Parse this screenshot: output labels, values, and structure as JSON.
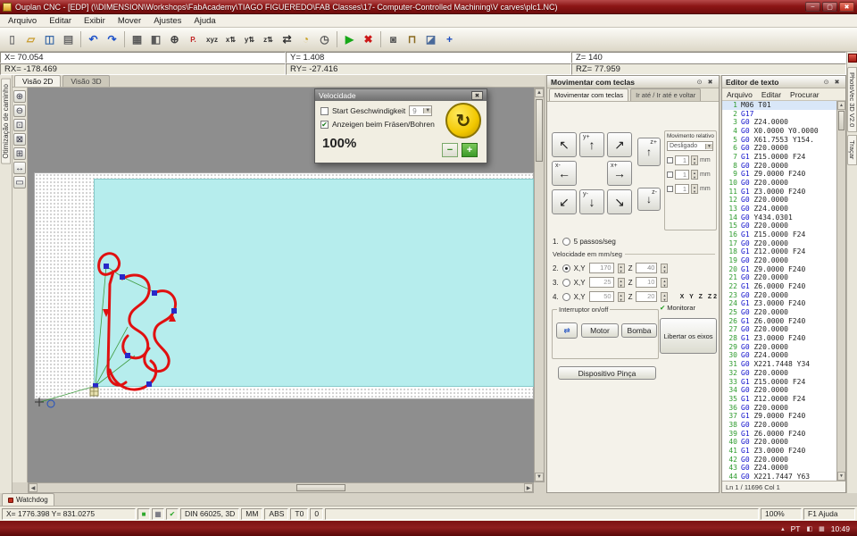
{
  "window": {
    "title": "Ouplan CNC - [EDP] (\\\\DIMENSION\\Workshops\\FabAcademy\\TIAGO FIGUEREDO\\FAB Classes\\17- Computer-Controlled Machining\\V carves\\plc1.NC)",
    "menus": [
      "Arquivo",
      "Editar",
      "Exibir",
      "Mover",
      "Ajustes",
      "Ajuda"
    ],
    "controls": {
      "min": "–",
      "max": "▢",
      "close": "✖"
    }
  },
  "toolbar": {
    "icons": [
      {
        "name": "new-file",
        "glyph": "▯",
        "color": "#7a7a7a"
      },
      {
        "name": "open-folder",
        "glyph": "▱",
        "color": "#c89a2a"
      },
      {
        "name": "save",
        "glyph": "◫",
        "color": "#3a6aa8"
      },
      {
        "name": "print",
        "glyph": "▤",
        "color": "#6a6a6a"
      },
      {
        "sep": true
      },
      {
        "name": "undo",
        "glyph": "↶",
        "color": "#1b50c8"
      },
      {
        "name": "redo",
        "glyph": "↷",
        "color": "#1b50c8"
      },
      {
        "sep": true
      },
      {
        "name": "grid-view",
        "glyph": "▦",
        "color": "#5a5a5a"
      },
      {
        "name": "layout",
        "glyph": "◧",
        "color": "#5a5a5a"
      },
      {
        "name": "zoom-tool",
        "glyph": "⊕",
        "color": "#444444"
      },
      {
        "name": "edit-p",
        "glyph": "P.",
        "color": "#c02020"
      },
      {
        "name": "axes-xyz",
        "glyph": "xyz",
        "color": "#333333"
      },
      {
        "name": "axis-x",
        "glyph": "x⇅",
        "color": "#333333"
      },
      {
        "name": "axis-y",
        "glyph": "y⇅",
        "color": "#333333"
      },
      {
        "name": "axis-z",
        "glyph": "z⇅",
        "color": "#333333"
      },
      {
        "name": "offsets",
        "glyph": "⇄",
        "color": "#333333"
      },
      {
        "name": "protractor",
        "glyph": "◔",
        "color": "#c8a020"
      },
      {
        "name": "timer",
        "glyph": "◷",
        "color": "#5a5a5a"
      },
      {
        "sep": true
      },
      {
        "name": "run",
        "glyph": "▶",
        "color": "#18a818"
      },
      {
        "name": "stop",
        "glyph": "✖",
        "color": "#cc1818"
      },
      {
        "sep": true
      },
      {
        "name": "snapshot",
        "glyph": "◙",
        "color": "#5a5a5a"
      },
      {
        "name": "scale",
        "glyph": "⊓",
        "color": "#8a6a20"
      },
      {
        "name": "report",
        "glyph": "◪",
        "color": "#4a6a9a"
      },
      {
        "name": "move-cross",
        "glyph": "+",
        "color": "#2050c0"
      }
    ]
  },
  "coords": {
    "x": "X= 70.054",
    "y": "Y= 1.408",
    "z": "Z= 140",
    "rx": "RX= -178.469",
    "ry": "RY= -27.416",
    "rz": "RZ= 77.959"
  },
  "left_tab": "Otimização de caminho",
  "view_tabs": {
    "t2d": "Visão 2D",
    "t3d": "Visão 3D"
  },
  "zoom_tools": [
    {
      "name": "zoom-in",
      "glyph": "⊕"
    },
    {
      "name": "zoom-out",
      "glyph": "⊖"
    },
    {
      "name": "zoom-window",
      "glyph": "⊡"
    },
    {
      "name": "zoom-fit",
      "glyph": "⊠"
    },
    {
      "name": "zoom-extents",
      "glyph": "⊞"
    },
    {
      "name": "pan",
      "glyph": "↔"
    },
    {
      "name": "measure",
      "glyph": "▭"
    }
  ],
  "velocity_dialog": {
    "title": "Velocidade",
    "close": "✖",
    "check_start": "Start Geschwindigkeit",
    "start_value": "9",
    "check_show": "Anzeigen beim Fräsen/Bohren",
    "check_glyph": "✔",
    "percent": "100%",
    "go_glyph": "↻",
    "minus": "−",
    "plus": "+"
  },
  "panel_icons": {
    "pin": "⊙",
    "close": "✖"
  },
  "jog": {
    "title": "Movimentar com teclas",
    "tab_active": "Movimentar com teclas",
    "tab2": "Ir até / Ir até e voltar",
    "buttons": [
      {
        "glyph": "↖",
        "label": ""
      },
      {
        "glyph": "↑",
        "label": "y+"
      },
      {
        "glyph": "↗",
        "label": ""
      },
      {
        "glyph": "←",
        "label": "x-"
      },
      {
        "glyph": "→",
        "label": "x+"
      },
      {
        "glyph": "↙",
        "label": ""
      },
      {
        "glyph": "↓",
        "label": "y-"
      },
      {
        "glyph": "↘",
        "label": ""
      }
    ],
    "z_plus": {
      "glyph": "↑",
      "label": "z+"
    },
    "z_minus": {
      "glyph": "↓",
      "label": "z-"
    },
    "relative": {
      "title": "Movimento relativo",
      "mode": "Desligado",
      "rows": [
        {
          "value": "1",
          "unit": "mm"
        },
        {
          "value": "1",
          "unit": "mm"
        },
        {
          "value": "1",
          "unit": "mm"
        }
      ]
    },
    "step_row": {
      "num": "1.",
      "label": "5 passos/seg"
    },
    "speed_group": "Velocidade em mm/seg",
    "speed_rows": [
      {
        "num": "2.",
        "xy_label": "X,Y",
        "xy": "170",
        "z_label": "Z",
        "z": "40"
      },
      {
        "num": "3.",
        "xy_label": "X,Y",
        "xy": "25",
        "z_label": "Z",
        "z": "10"
      },
      {
        "num": "4.",
        "xy_label": "X,Y",
        "xy": "50",
        "z_label": "Z",
        "z": "20"
      }
    ],
    "switch_group": "Interruptor on/off",
    "switch_icon": "⇄",
    "motor": "Motor",
    "bomba": "Bomba",
    "monitor_check": "✔",
    "monitor": "Monitorar",
    "monitor_axes": "X Y Z Z2",
    "release": "Libertar os eixos",
    "pinca": "Dispositivo Pinça"
  },
  "editor": {
    "title": "Editor de texto",
    "menus": [
      "Arquivo",
      "Editar",
      "Procurar"
    ],
    "status": "Ln 1 / 11696   Col 1",
    "lines": [
      {
        "n": 1,
        "c": "M06 T01"
      },
      {
        "n": 2,
        "c": "G17"
      },
      {
        "n": 3,
        "c": "G0 Z24.0000"
      },
      {
        "n": 4,
        "c": "G0 X0.0000 Y0.0000"
      },
      {
        "n": 5,
        "c": "G0 X61.7553 Y154."
      },
      {
        "n": 6,
        "c": "G0 Z20.0000"
      },
      {
        "n": 7,
        "c": "G1 Z15.0000 F24"
      },
      {
        "n": 8,
        "c": "G0 Z20.0000"
      },
      {
        "n": 9,
        "c": "G1 Z9.0000 F240"
      },
      {
        "n": 10,
        "c": "G0 Z20.0000"
      },
      {
        "n": 11,
        "c": "G1 Z3.0000 F240"
      },
      {
        "n": 12,
        "c": "G0 Z20.0000"
      },
      {
        "n": 13,
        "c": "G0 Z24.0000"
      },
      {
        "n": 14,
        "c": "G0 Y434.0301"
      },
      {
        "n": 15,
        "c": "G0 Z20.0000"
      },
      {
        "n": 16,
        "c": "G1 Z15.0000 F24"
      },
      {
        "n": 17,
        "c": "G0 Z20.0000"
      },
      {
        "n": 18,
        "c": "G1 Z12.0000 F24"
      },
      {
        "n": 19,
        "c": "G0 Z20.0000"
      },
      {
        "n": 20,
        "c": "G1 Z9.0000 F240"
      },
      {
        "n": 21,
        "c": "G0 Z20.0000"
      },
      {
        "n": 22,
        "c": "G1 Z6.0000 F240"
      },
      {
        "n": 23,
        "c": "G0 Z20.0000"
      },
      {
        "n": 24,
        "c": "G1 Z3.0000 F240"
      },
      {
        "n": 25,
        "c": "G0 Z20.0000"
      },
      {
        "n": 26,
        "c": "G1 Z6.0000 F240"
      },
      {
        "n": 27,
        "c": "G0 Z20.0000"
      },
      {
        "n": 28,
        "c": "G1 Z3.0000 F240"
      },
      {
        "n": 29,
        "c": "G0 Z20.0000"
      },
      {
        "n": 30,
        "c": "G0 Z24.0000"
      },
      {
        "n": 31,
        "c": "G0 X221.7448 Y34"
      },
      {
        "n": 32,
        "c": "G0 Z20.0000"
      },
      {
        "n": 33,
        "c": "G1 Z15.0000 F24"
      },
      {
        "n": 34,
        "c": "G0 Z20.0000"
      },
      {
        "n": 35,
        "c": "G1 Z12.0000 F24"
      },
      {
        "n": 36,
        "c": "G0 Z20.0000"
      },
      {
        "n": 37,
        "c": "G1 Z9.0000 F240"
      },
      {
        "n": 38,
        "c": "G0 Z20.0000"
      },
      {
        "n": 39,
        "c": "G1 Z6.0000 F240"
      },
      {
        "n": 40,
        "c": "G0 Z20.0000"
      },
      {
        "n": 41,
        "c": "G1 Z3.0000 F240"
      },
      {
        "n": 42,
        "c": "G0 Z20.0000"
      },
      {
        "n": 43,
        "c": "G0 Z24.0000"
      },
      {
        "n": 44,
        "c": "G0 X221.7447 Y63"
      }
    ]
  },
  "right_tabs": {
    "top": "PhotoVec 3D V2.0",
    "bottom": "Traçar"
  },
  "watchdog": "Watchdog",
  "statusbar": {
    "coords": "X= 1776.398 Y= 831.0275",
    "icons": [
      {
        "name": "connection-status-icon",
        "glyph": "■",
        "color": "#2da82d"
      },
      {
        "name": "grid-status-icon",
        "glyph": "▦",
        "color": "#556"
      },
      {
        "name": "ok-status-icon",
        "glyph": "✔",
        "color": "#2da82d"
      }
    ],
    "din": "DIN 66025, 3D",
    "units": "MM",
    "abs": "ABS",
    "tool": "T0",
    "zero": "0",
    "zoom": "100%",
    "help": "F1 Ajuda"
  },
  "taskbar": {
    "tray_icons": [
      "▴",
      "◧",
      "▦"
    ],
    "lang": "PT",
    "time": "10:49"
  }
}
